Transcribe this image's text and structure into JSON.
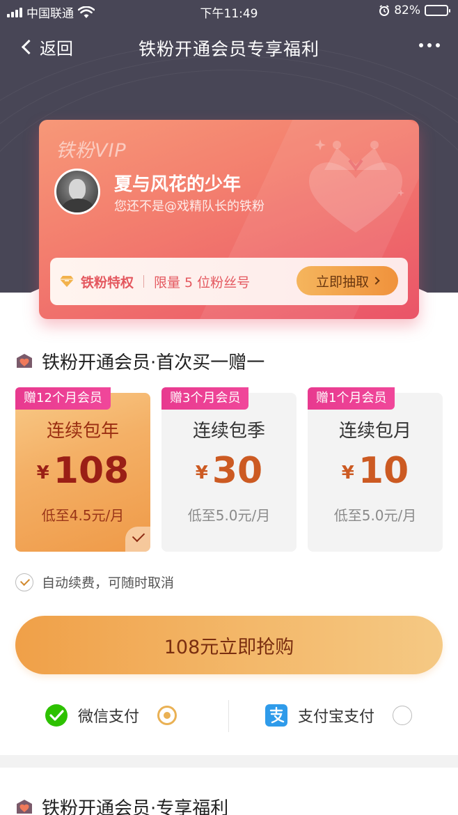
{
  "status_bar": {
    "carrier": "中国联通",
    "time": "下午11:49",
    "battery_percent": "82%",
    "battery_level": 0.82
  },
  "nav": {
    "back_label": "返回",
    "title": "铁粉开通会员专享福利"
  },
  "vip_card": {
    "brand": "铁粉VIP",
    "user_name": "夏与风花的少年",
    "subtitle": "您还不是@戏精队长的铁粉",
    "privilege_label": "铁粉特权",
    "limit_text": "限量 5 位粉丝号",
    "draw_button": "立即抽取"
  },
  "section1": {
    "title": "铁粉开通会员·首次买一赠一"
  },
  "plans": [
    {
      "tag": "赠12个月会员",
      "name": "连续包年",
      "currency": "¥",
      "price": "108",
      "note": "低至4.5元/月",
      "selected": true
    },
    {
      "tag": "赠3个月会员",
      "name": "连续包季",
      "currency": "¥",
      "price": "30",
      "note": "低至5.0元/月",
      "selected": false
    },
    {
      "tag": "赠1个月会员",
      "name": "连续包月",
      "currency": "¥",
      "price": "10",
      "note": "低至5.0元/月",
      "selected": false
    }
  ],
  "auto_renew": {
    "label": "自动续费，可随时取消",
    "checked": true
  },
  "buy_button": "108元立即抢购",
  "payment": {
    "wechat_label": "微信支付",
    "wechat_selected": true,
    "alipay_label": "支付宝支付",
    "alipay_selected": false
  },
  "section2": {
    "title": "铁粉开通会员·专享福利"
  },
  "colors": {
    "header_bg": "#484656",
    "card_start": "#f79878",
    "card_end": "#ea5468",
    "accent_orange": "#f0a048",
    "price_red": "#9a1f16",
    "tag_pink": "#e83a8f"
  },
  "icons": {
    "signal": "signal-icon",
    "wifi": "wifi-icon",
    "alarm": "alarm-icon",
    "battery": "battery-icon",
    "back": "chevron-left-icon",
    "more": "more-dots-icon",
    "crown": "crown-heart-icon",
    "gem": "diamond-icon",
    "section": "vip-badge-icon",
    "wechat": "wechat-pay-icon",
    "alipay": "alipay-icon",
    "check": "check-icon"
  }
}
